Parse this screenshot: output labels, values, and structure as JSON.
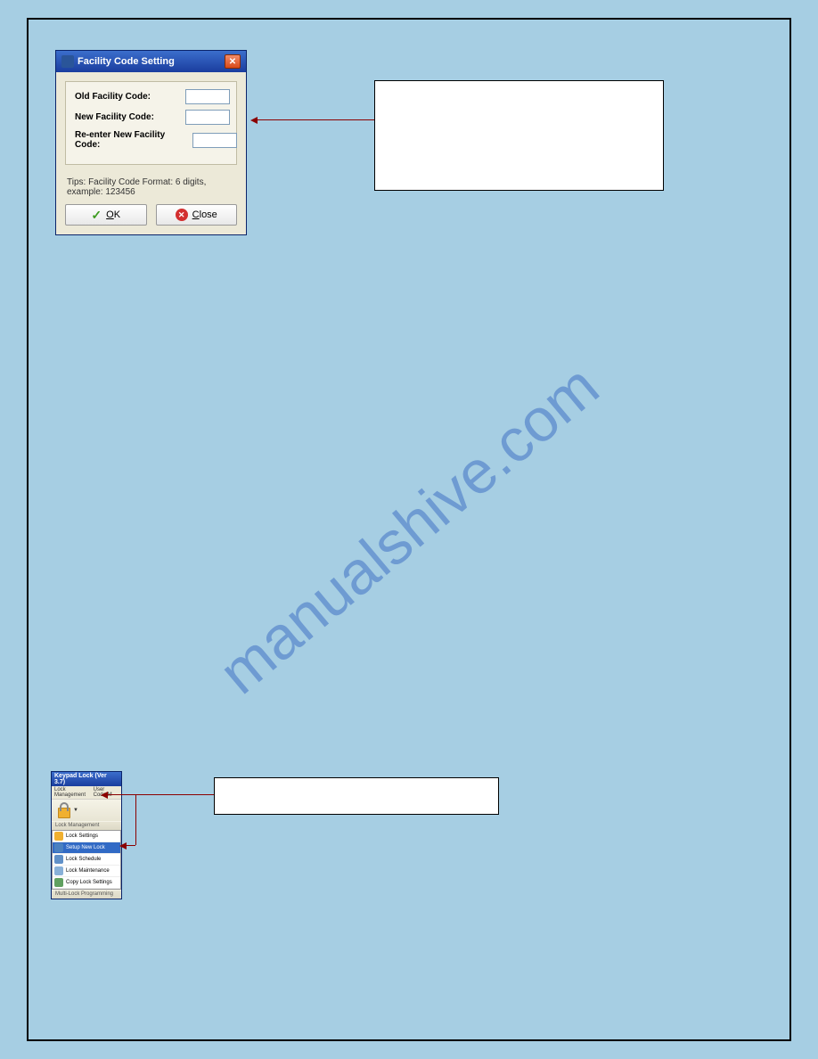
{
  "watermark": "manualshive.com",
  "dialog1": {
    "title": "Facility Code Setting",
    "fields": {
      "old_label": "Old Facility Code:",
      "new_label": "New Facility Code:",
      "re_label": "Re-enter New Facility Code:"
    },
    "tips": "Tips: Facility Code Format: 6 digits, example: 123456",
    "buttons": {
      "ok": "OK",
      "close": "Close"
    }
  },
  "app2": {
    "title": "Keypad Lock (Ver 3.7)",
    "menubar": {
      "item1": "Lock Management",
      "item2": "User Code M"
    },
    "sections": {
      "s1": "Lock Management",
      "s2": "Multi-Lock Programming"
    },
    "menu": {
      "m1": "Lock Settings",
      "m2": "Setup New Lock",
      "m3": "Lock Schedule",
      "m4": "Lock Maintenance",
      "m5": "Copy Lock Settings"
    }
  }
}
